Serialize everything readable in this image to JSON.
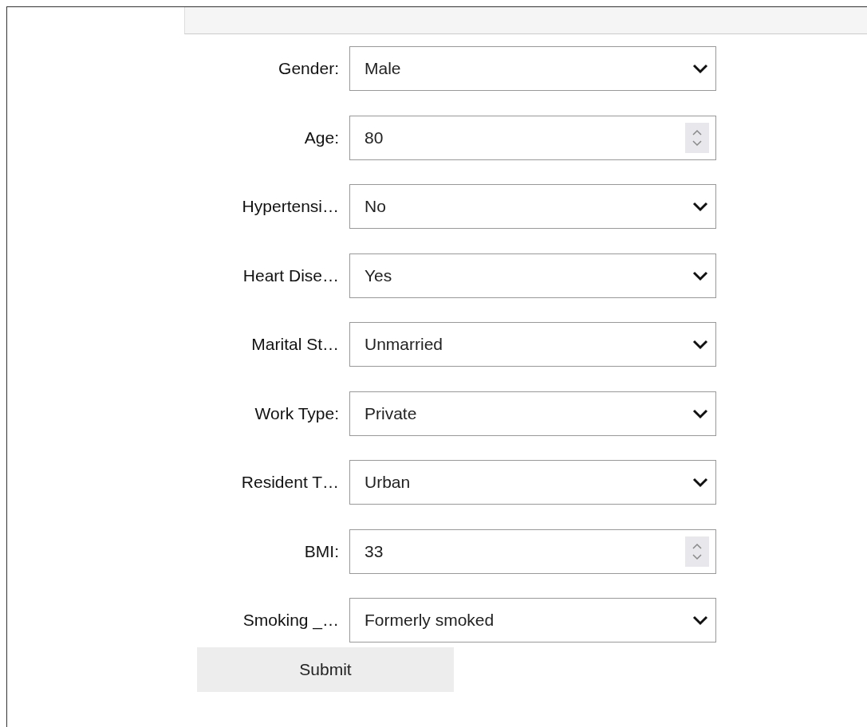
{
  "header_bar": {
    "kind": "bar"
  },
  "fields": [
    {
      "label": "Gender:",
      "kind": "select",
      "value": "Male"
    },
    {
      "label": "Age:",
      "kind": "number",
      "value": "80"
    },
    {
      "label": "Hypertensi…",
      "kind": "select",
      "value": "No"
    },
    {
      "label": "Heart Dise…",
      "kind": "select",
      "value": "Yes"
    },
    {
      "label": "Marital St…",
      "kind": "select",
      "value": "Unmarried"
    },
    {
      "label": "Work Type:",
      "kind": "select",
      "value": "Private"
    },
    {
      "label": "Resident T…",
      "kind": "select",
      "value": "Urban"
    },
    {
      "label": "BMI:",
      "kind": "number",
      "value": "33"
    },
    {
      "label": "Smoking _…",
      "kind": "select",
      "value": "Formerly smoked"
    }
  ],
  "submit": {
    "label": "Submit"
  }
}
